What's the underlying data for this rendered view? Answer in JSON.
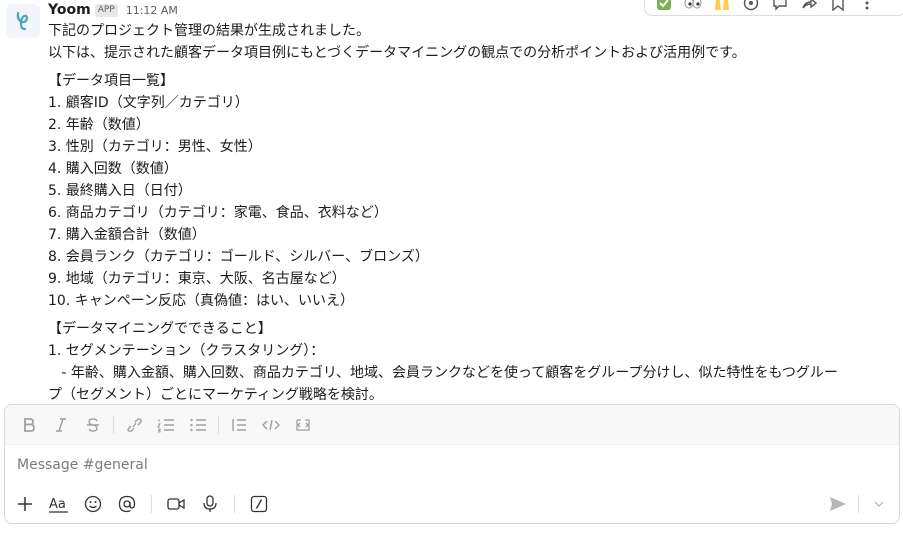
{
  "message": {
    "sender": "Yoom",
    "badge": "APP",
    "time": "11:12 AM",
    "lines": [
      "下記のプロジェクト管理の結果が生成されました。",
      "以下は、提示された顧客データ項目例にもとづくデータマイニングの観点での分析ポイントおよび活用例です。",
      "【データ項目一覧】",
      "1. 顧客ID（文字列／カテゴリ）",
      "2. 年齢（数値）",
      "3. 性別（カテゴリ：男性、女性）",
      "4. 購入回数（数値）",
      "5. 最終購入日（日付）",
      "6. 商品カテゴリ（カテゴリ：家電、食品、衣料など）",
      "7. 購入金額合計（数値）",
      "8. 会員ランク（カテゴリ：ゴールド、シルバー、ブロンズ）",
      "9. 地域（カテゴリ：東京、大阪、名古屋など）",
      "10. キャンペーン反応（真偽値：はい、いいえ）",
      "【データマイニングでできること】",
      "1. セグメンテーション（クラスタリング）：",
      "   - 年齢、購入金額、購入回数、商品カテゴリ、地域、会員ランクなどを使って顧客をグループ分けし、似た特性をもつグルー",
      "プ（セグメント）ごとにマーケティング戦略を検討。"
    ]
  },
  "reactions": [
    "white-check-mark-icon",
    "eyes-icon",
    "raised-hands-icon",
    "add-reaction-icon",
    "reply-thread-icon",
    "share-icon",
    "bookmark-icon",
    "more-icon"
  ],
  "composer": {
    "placeholder": "Message #general",
    "format_tools": [
      "bold-icon",
      "italic-icon",
      "strikethrough-icon",
      "link-icon",
      "ordered-list-icon",
      "bulleted-list-icon",
      "blockquote-icon",
      "code-icon",
      "code-block-icon"
    ],
    "bottom_tools": [
      "plus-icon",
      "text-format-icon",
      "emoji-icon",
      "mention-icon",
      "video-clip-icon",
      "microphone-icon",
      "slash-command-icon"
    ],
    "format_label": "Aa"
  },
  "colors": {
    "text": "#1d1c1d",
    "muted": "#616061",
    "accent": "#4ba3c7"
  }
}
